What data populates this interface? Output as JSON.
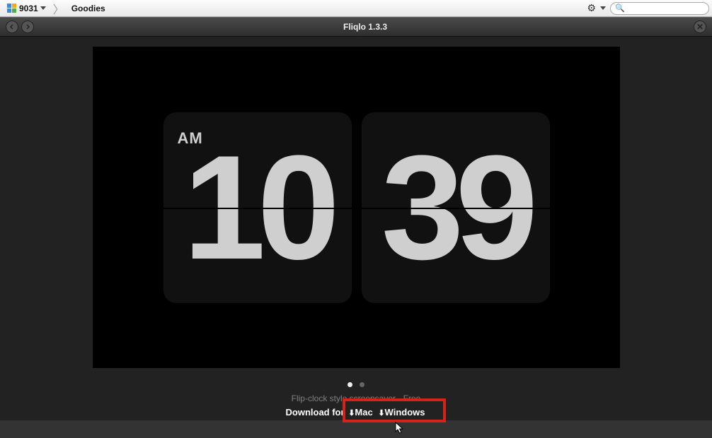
{
  "toolbar": {
    "site_id": "9031",
    "crumb": "Goodies",
    "search_placeholder": ""
  },
  "titlebar": {
    "title": "Fliqlo 1.3.3"
  },
  "preview": {
    "ampm": "AM",
    "hours": "10",
    "minutes": "39"
  },
  "caption": "Flip-clock style screensaver - Free",
  "download": {
    "label": "Download for",
    "mac": "Mac",
    "windows": "Windows"
  },
  "colors": {
    "highlight": "#d3241a"
  }
}
